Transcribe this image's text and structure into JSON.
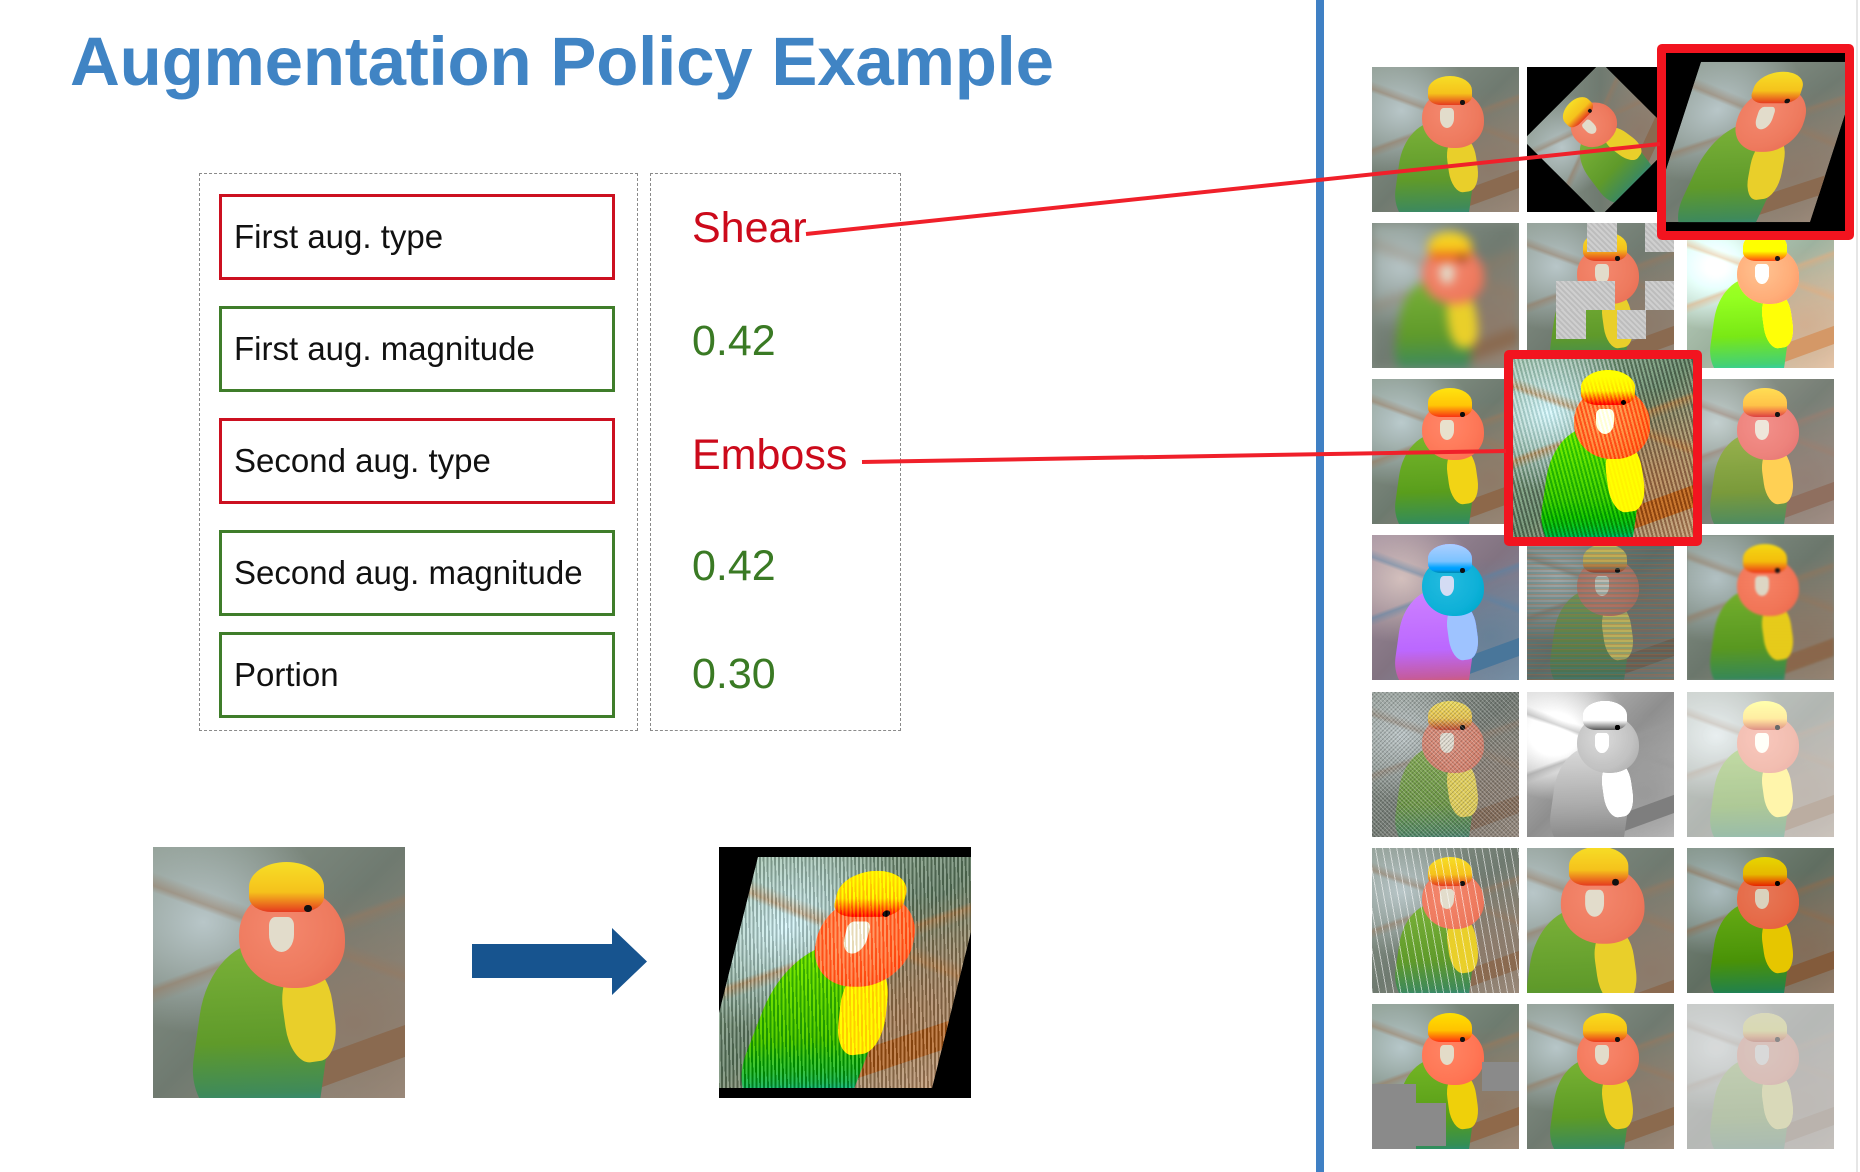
{
  "title": "Augmentation Policy Example",
  "policy": {
    "rows": [
      {
        "label": "First aug. type",
        "value": "Shear",
        "kind": "type"
      },
      {
        "label": "First aug. magnitude",
        "value": "0.42",
        "kind": "magnitude"
      },
      {
        "label": "Second aug. type",
        "value": "Emboss",
        "kind": "type"
      },
      {
        "label": "Second aug. magnitude",
        "value": "0.42",
        "kind": "magnitude"
      },
      {
        "label": "Portion",
        "value": "0.30",
        "kind": "magnitude"
      }
    ]
  },
  "colors": {
    "title": "#4084c4",
    "type_accent": "#cc0a1b",
    "magnitude_accent": "#3a7a24",
    "highlight": "#f2141f",
    "arrow": "#17548f",
    "divider": "#3f80c4"
  },
  "example": {
    "input_image": "original-parrot-image",
    "arrow": "arrow-right-icon",
    "output_image": "sheared-embossed-parrot-image"
  },
  "gallery": {
    "columns": 3,
    "rows": 7,
    "highlighted": [
      {
        "cell": "row1-col3",
        "augmentation": "Shear"
      },
      {
        "cell": "row3-col2",
        "augmentation": "Emboss"
      }
    ],
    "cells": [
      "original",
      "rotate",
      "shear",
      "blur",
      "cutout",
      "brightness",
      "elastic",
      "emboss",
      "color-shift",
      "invert",
      "stripes",
      "wave",
      "noise",
      "solarize",
      "fog",
      "rain",
      "zoom",
      "contrast",
      "segment",
      "mirror",
      "faded"
    ]
  }
}
